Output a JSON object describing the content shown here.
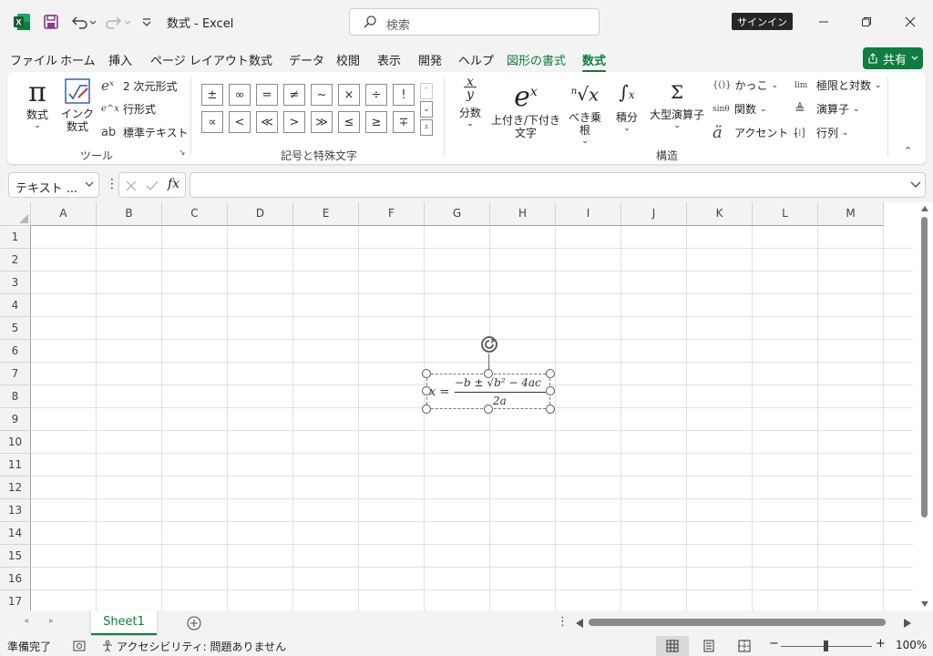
{
  "window": {
    "doc_title": "数式  -  Excel",
    "search_placeholder": "検索",
    "signin_label": "サインイン"
  },
  "menu_tabs": [
    {
      "label": "ファイル"
    },
    {
      "label": "ホーム"
    },
    {
      "label": "挿入"
    },
    {
      "label": "ページ レイアウト"
    },
    {
      "label": "数式"
    },
    {
      "label": "データ"
    },
    {
      "label": "校閲"
    },
    {
      "label": "表示"
    },
    {
      "label": "開発"
    },
    {
      "label": "ヘルプ"
    },
    {
      "label": "図形の書式"
    },
    {
      "label": "数式"
    }
  ],
  "share_label": "共有",
  "ribbon": {
    "tools": {
      "group_label": "ツール",
      "equation_label": "数式",
      "ink_label_1": "インク",
      "ink_label_2": "数式",
      "professional": "2 次元形式",
      "linear": "行形式",
      "normal_text": "標準テキスト"
    },
    "symbols": {
      "group_label": "記号と特殊文字",
      "row1": [
        "±",
        "∞",
        "=",
        "≠",
        "~",
        "×",
        "÷",
        "!"
      ],
      "row2": [
        "∝",
        "<",
        "≪",
        ">",
        "≫",
        "≤",
        "≥",
        "∓"
      ]
    },
    "structures": {
      "group_label": "構造",
      "fraction": "分数",
      "script_1": "上付き/下付き",
      "script_2": "文字",
      "radical": "べき乗根",
      "integral": "積分",
      "large_operator": "大型演算子",
      "bracket": "かっこ",
      "function": "関数",
      "accent": "アクセント",
      "limit_log": "極限と対数",
      "operator": "演算子",
      "matrix": "行列"
    }
  },
  "formula_bar": {
    "name_box": "テキスト ...",
    "fx": "fx",
    "value": ""
  },
  "columns": [
    "A",
    "B",
    "C",
    "D",
    "E",
    "F",
    "G",
    "H",
    "I",
    "J",
    "K",
    "L",
    "M"
  ],
  "rows": [
    "1",
    "2",
    "3",
    "4",
    "5",
    "6",
    "7",
    "8",
    "9",
    "10",
    "11",
    "12",
    "13",
    "14",
    "15",
    "16",
    "17"
  ],
  "equation": {
    "lhs": "x =",
    "numerator": "−b ± √b² − 4ac",
    "denominator": "2a"
  },
  "sheets": [
    {
      "label": "Sheet1"
    }
  ],
  "status": {
    "ready": "準備完了",
    "accessibility": "アクセシビリティ: 問題ありません",
    "zoom": "100%"
  },
  "colors": {
    "accent": "#107c41",
    "signin_bg": "#262626"
  }
}
